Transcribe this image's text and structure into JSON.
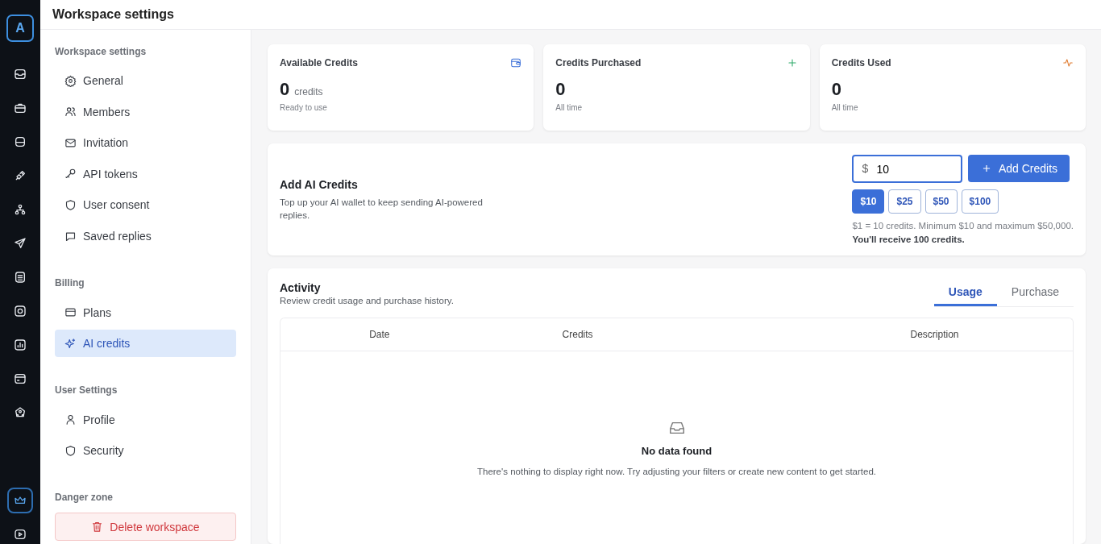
{
  "header": {
    "title": "Workspace settings"
  },
  "rail": {
    "logo": "A",
    "items": [
      {
        "selected": false
      },
      {
        "selected": false
      },
      {
        "selected": false
      },
      {
        "selected": false
      },
      {
        "selected": false
      },
      {
        "selected": false
      },
      {
        "selected": false
      },
      {
        "selected": false
      },
      {
        "selected": false
      },
      {
        "selected": false
      },
      {
        "selected": false
      }
    ],
    "bottom_items": [
      {
        "selected": true
      },
      {
        "selected": false
      }
    ]
  },
  "settings_nav": {
    "sections": [
      {
        "title": "Workspace settings",
        "items": [
          {
            "label": "General",
            "selected": false
          },
          {
            "label": "Members",
            "selected": false
          },
          {
            "label": "Invitation",
            "selected": false
          },
          {
            "label": "API tokens",
            "selected": false
          },
          {
            "label": "User consent",
            "selected": false
          },
          {
            "label": "Saved replies",
            "selected": false
          }
        ]
      },
      {
        "title": "Billing",
        "items": [
          {
            "label": "Plans",
            "selected": false
          },
          {
            "label": "AI credits",
            "selected": true
          }
        ]
      },
      {
        "title": "User Settings",
        "items": [
          {
            "label": "Profile",
            "selected": false
          },
          {
            "label": "Security",
            "selected": false
          }
        ]
      }
    ],
    "danger_zone": {
      "title": "Danger zone",
      "button": "Delete workspace"
    }
  },
  "summary_cards": [
    {
      "title": "Available Credits",
      "value": "0",
      "unit": "credits",
      "subtitle": "Ready to use"
    },
    {
      "title": "Credits Purchased",
      "value": "0",
      "subtitle": "All time"
    },
    {
      "title": "Credits Used",
      "value": "0",
      "subtitle": "All time"
    }
  ],
  "add_credits": {
    "title": "Add AI Credits",
    "description": "Top up your AI wallet to keep sending AI-powered replies.",
    "currency": "$",
    "amount": "10",
    "button": "Add Credits",
    "presets": [
      {
        "label": "$10",
        "selected": true
      },
      {
        "label": "$25",
        "selected": false
      },
      {
        "label": "$50",
        "selected": false
      },
      {
        "label": "$100",
        "selected": false
      }
    ],
    "note": "$1 = 10 credits. Minimum $10 and maximum $50,000.",
    "receive": "You'll receive 100 credits."
  },
  "activity": {
    "title": "Activity",
    "subtitle": "Review credit usage and purchase history.",
    "tabs": [
      {
        "label": "Usage",
        "selected": true
      },
      {
        "label": "Purchase",
        "selected": false
      }
    ],
    "table": {
      "columns": [
        "Date",
        "Credits",
        "Description"
      ]
    },
    "empty_state": {
      "title": "No data found",
      "message": "There's nothing to display right now. Try adjusting your filters or create new content to get started."
    }
  }
}
